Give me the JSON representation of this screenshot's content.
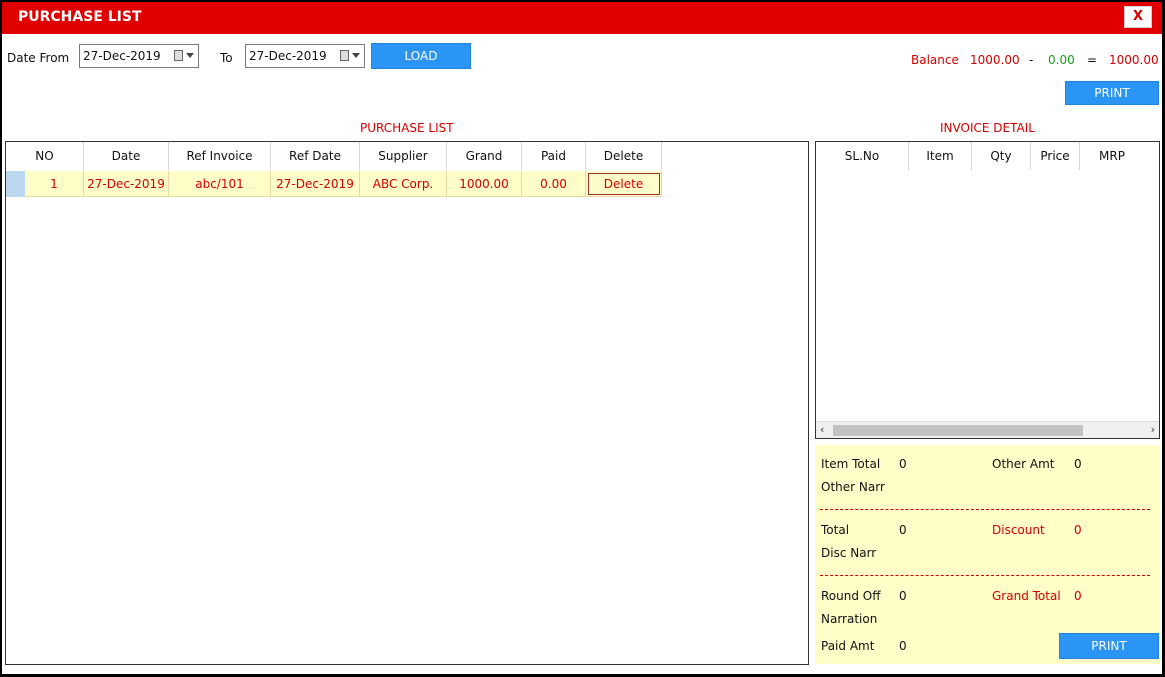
{
  "window": {
    "title": "PURCHASE LIST",
    "close_label": "X"
  },
  "filter": {
    "date_from_label": "Date From",
    "date_from_value": "27-Dec-2019",
    "to_label": "To",
    "date_to_value": "27-Dec-2019",
    "load_label": "LOAD"
  },
  "balance": {
    "label": "Balance",
    "value1": "1000.00",
    "minus": "-",
    "value2": "0.00",
    "equals": "=",
    "result": "1000.00"
  },
  "print_top_label": "PRINT",
  "purchase_list": {
    "title": "PURCHASE LIST",
    "columns": [
      "NO",
      "Date",
      "Ref Invoice",
      "Ref Date",
      "Supplier",
      "Grand",
      "Paid",
      "Delete"
    ],
    "rows": [
      {
        "no": "1",
        "date": "27-Dec-2019",
        "ref_invoice": "abc/101",
        "ref_date": "27-Dec-2019",
        "supplier": "ABC Corp.",
        "grand": "1000.00",
        "paid": "0.00",
        "delete_label": "Delete"
      }
    ]
  },
  "invoice_detail": {
    "title": "INVOICE DETAIL",
    "columns": [
      "SL.No",
      "Item",
      "Qty",
      "Price",
      "MRP"
    ]
  },
  "summary": {
    "item_total_label": "Item Total",
    "item_total_value": "0",
    "other_amt_label": "Other Amt",
    "other_amt_value": "0",
    "other_narr_label": "Other Narr",
    "total_label": "Total",
    "total_value": "0",
    "discount_label": "Discount",
    "discount_value": "0",
    "disc_narr_label": "Disc Narr",
    "round_off_label": "Round Off",
    "round_off_value": "0",
    "grand_total_label": "Grand Total",
    "grand_total_value": "0",
    "narration_label": "Narration",
    "paid_amt_label": "Paid Amt",
    "paid_amt_value": "0",
    "print_label": "PRINT"
  },
  "colors": {
    "title_bar": "#e00000",
    "accent_blue": "#2b95f5",
    "row_highlight": "#fffdc8",
    "text_red": "#d40000",
    "text_green": "#1a9e1a"
  }
}
